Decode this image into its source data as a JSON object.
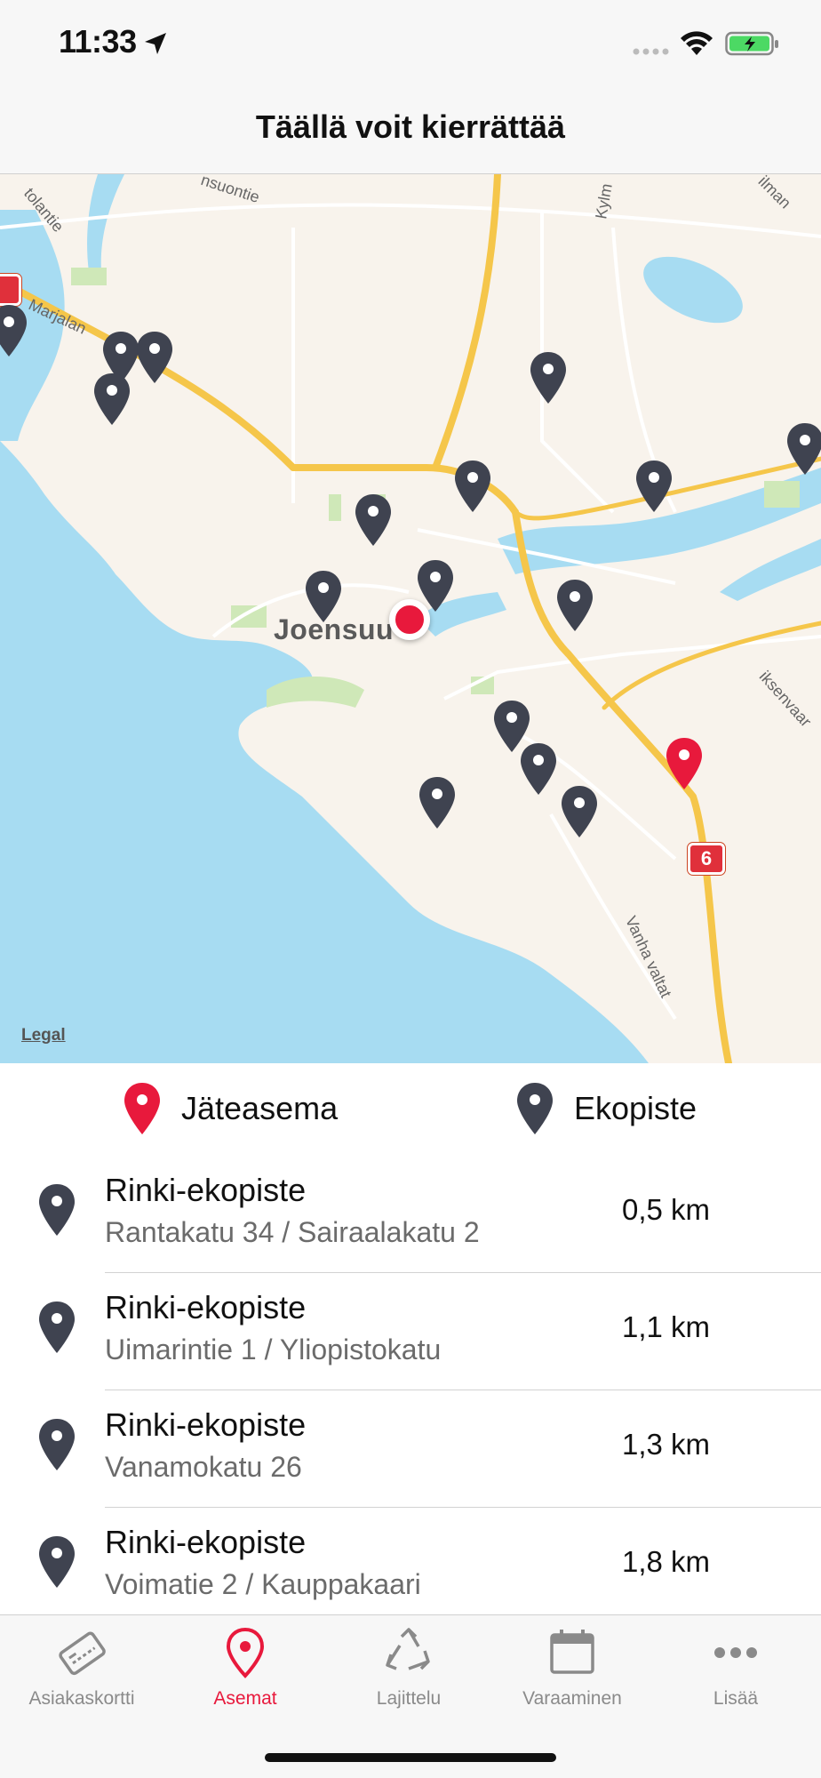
{
  "status_bar": {
    "time": "11:33"
  },
  "nav": {
    "title": "Täällä voit kierrättää"
  },
  "map": {
    "city_label": "Joensuu",
    "legal_label": "Legal",
    "road_labels": {
      "tolantie": "tolantie",
      "marjala": "Marjalan",
      "suontie": "nsuontie",
      "kylm": "Kylm",
      "iksenvaar": "iksenvaar",
      "vanha_valtat": "Vanha valtat",
      "ilmanr": "ilman"
    },
    "highway_number": "6",
    "colors": {
      "water": "#a7dcf2",
      "land": "#f8f3ec",
      "park": "#cfe8b8",
      "highway": "#f5c64a",
      "pin_ekopiste": "#3f4350",
      "pin_jateasema": "#e8193c"
    }
  },
  "legend": {
    "jateasema": "Jäteasema",
    "ekopiste": "Ekopiste"
  },
  "stations": [
    {
      "name": "Rinki-ekopiste",
      "address": "Rantakatu 34 / Sairaalakatu 2",
      "distance": "0,5 km",
      "icon": "ekopiste-pin-icon"
    },
    {
      "name": "Rinki-ekopiste",
      "address": "Uimarintie 1 / Yliopistokatu",
      "distance": "1,1 km",
      "icon": "ekopiste-pin-icon"
    },
    {
      "name": "Rinki-ekopiste",
      "address": "Vanamokatu 26",
      "distance": "1,3 km",
      "icon": "ekopiste-pin-icon"
    },
    {
      "name": "Rinki-ekopiste",
      "address": "Voimatie 2 / Kauppakaari",
      "distance": "1,8 km",
      "icon": "ekopiste-pin-icon"
    }
  ],
  "tabs": [
    {
      "label": "Asiakaskortti",
      "icon": "card-icon",
      "active": false
    },
    {
      "label": "Asemat",
      "icon": "location-pin-icon",
      "active": true
    },
    {
      "label": "Lajittelu",
      "icon": "recycle-icon",
      "active": false
    },
    {
      "label": "Varaaminen",
      "icon": "calendar-icon",
      "active": false
    },
    {
      "label": "Lisää",
      "icon": "more-icon",
      "active": false
    }
  ]
}
